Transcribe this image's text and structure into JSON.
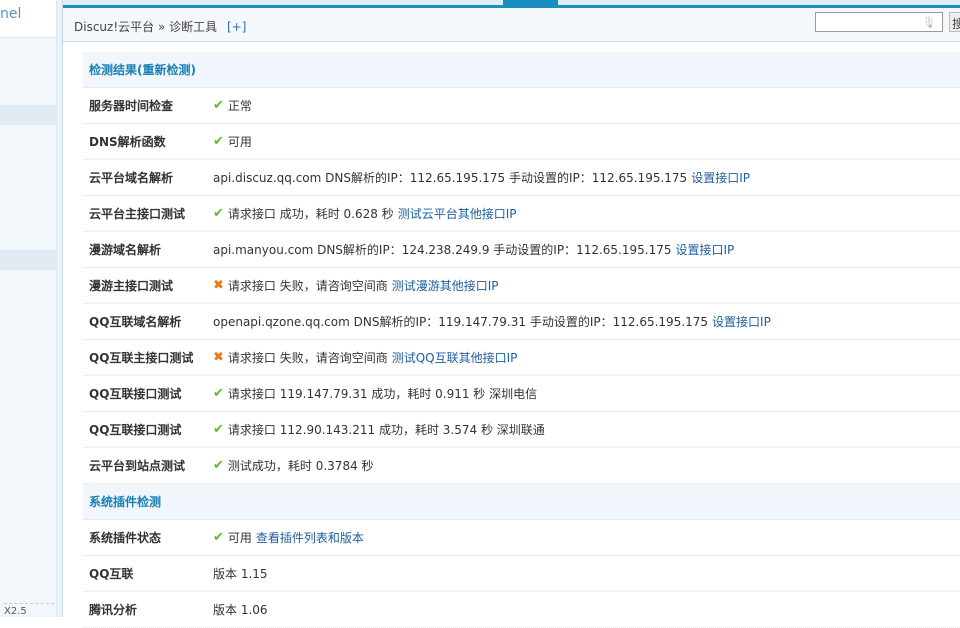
{
  "sidebar": {
    "logo_text": "nel",
    "version": "X2.5"
  },
  "breadcrumb": {
    "root": "Discuz!云平台",
    "sep": "»",
    "current": "诊断工具",
    "add": "[+]"
  },
  "search": {
    "placeholder": "",
    "button": "搜"
  },
  "sections": [
    {
      "title": "检测结果(重新检测)",
      "rows": [
        {
          "label": "服务器时间检查",
          "status": "ok",
          "text": "正常",
          "link": ""
        },
        {
          "label": "DNS解析函数",
          "status": "ok",
          "text": "可用",
          "link": ""
        },
        {
          "label": "云平台域名解析",
          "status": "",
          "text": "api.discuz.qq.com DNS解析的IP：112.65.195.175 手动设置的IP：112.65.195.175",
          "link": "设置接口IP"
        },
        {
          "label": "云平台主接口测试",
          "status": "ok",
          "text": "请求接口 成功，耗时 0.628 秒",
          "link": "测试云平台其他接口IP"
        },
        {
          "label": "漫游域名解析",
          "status": "",
          "text": "api.manyou.com DNS解析的IP：124.238.249.9 手动设置的IP：112.65.195.175",
          "link": "设置接口IP"
        },
        {
          "label": "漫游主接口测试",
          "status": "err",
          "text": "请求接口 失败，请咨询空间商",
          "link": "测试漫游其他接口IP"
        },
        {
          "label": "QQ互联域名解析",
          "status": "",
          "text": "openapi.qzone.qq.com DNS解析的IP：119.147.79.31 手动设置的IP：112.65.195.175",
          "link": "设置接口IP"
        },
        {
          "label": "QQ互联主接口测试",
          "status": "err",
          "text": "请求接口 失败，请咨询空间商",
          "link": "测试QQ互联其他接口IP"
        },
        {
          "label": "QQ互联接口测试",
          "status": "ok",
          "text": "请求接口 119.147.79.31 成功，耗时 0.911 秒 深圳电信",
          "link": ""
        },
        {
          "label": "QQ互联接口测试",
          "status": "ok",
          "text": "请求接口 112.90.143.211 成功，耗时 3.574 秒 深圳联通",
          "link": ""
        },
        {
          "label": "云平台到站点测试",
          "status": "ok",
          "text": "测试成功，耗时 0.3784 秒",
          "link": ""
        }
      ]
    },
    {
      "title": "系统插件检测",
      "rows": [
        {
          "label": "系统插件状态",
          "status": "ok",
          "text": "可用",
          "link": "查看插件列表和版本"
        },
        {
          "label": "QQ互联",
          "status": "",
          "text": "版本 1.15",
          "link": ""
        },
        {
          "label": "腾讯分析",
          "status": "",
          "text": "版本 1.06",
          "link": ""
        }
      ]
    }
  ],
  "icons": {
    "ok": "✔",
    "err": "✖"
  },
  "colors": {
    "accent": "#1a8ec1",
    "link": "#1f5fa0",
    "ok": "#5cb82e",
    "err": "#f07a12"
  }
}
